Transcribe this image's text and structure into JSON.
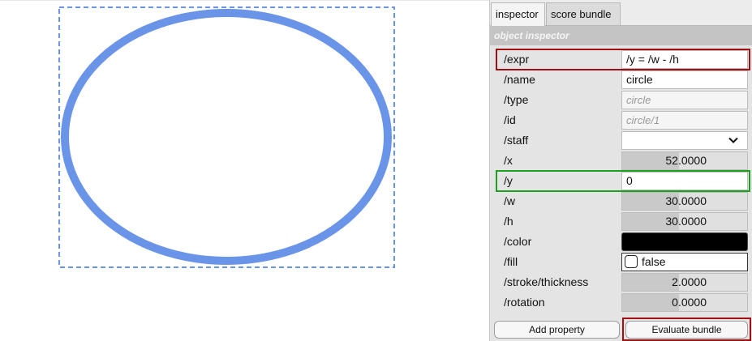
{
  "canvas": {
    "shape_color": "#6a94e8",
    "selection_color": "#6a94e8"
  },
  "tabs": [
    {
      "label": "inspector",
      "active": true
    },
    {
      "label": "score bundle",
      "active": false
    }
  ],
  "inspector": {
    "section_title": "object inspector",
    "rows": {
      "expr": {
        "label": "/expr",
        "value": "/y = /w - /h"
      },
      "name": {
        "label": "/name",
        "value": "circle"
      },
      "type": {
        "label": "/type",
        "value": "circle"
      },
      "id": {
        "label": "/id",
        "value": "circle/1"
      },
      "staff": {
        "label": "/staff",
        "value": ""
      },
      "x": {
        "label": "/x",
        "value": "52.0000"
      },
      "y": {
        "label": "/y",
        "value": "0"
      },
      "w": {
        "label": "/w",
        "value": "30.0000"
      },
      "h": {
        "label": "/h",
        "value": "30.0000"
      },
      "color": {
        "label": "/color",
        "value_color": "#000000"
      },
      "fill": {
        "label": "/fill",
        "value": "false"
      },
      "stroke_thickness": {
        "label": "/stroke/thickness",
        "value": "2.0000"
      },
      "rotation": {
        "label": "/rotation",
        "value": "0.0000"
      }
    },
    "add_property_label": "Add property",
    "evaluate_bundle_label": "Evaluate bundle"
  },
  "highlight_colors": {
    "red": "#a01010",
    "green": "#1f9e1f"
  }
}
